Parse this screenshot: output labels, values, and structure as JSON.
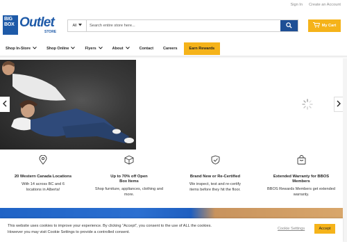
{
  "top_links": {
    "sign_in": "Sign In",
    "create_account": "Create an Account"
  },
  "logo": {
    "box_text": "BIG BOX",
    "outlet_text": "Outlet",
    "store_text": "STORE"
  },
  "search": {
    "category": "All",
    "placeholder": "Search entire store here..."
  },
  "cart": {
    "label": "My Cart"
  },
  "nav": {
    "items": [
      {
        "label": "Shop In-Store",
        "has_dropdown": true
      },
      {
        "label": "Shop Online",
        "has_dropdown": true
      },
      {
        "label": "Flyers",
        "has_dropdown": true
      },
      {
        "label": "About",
        "has_dropdown": true
      },
      {
        "label": "Contact",
        "has_dropdown": false
      },
      {
        "label": "Careers",
        "has_dropdown": false
      }
    ],
    "earn_rewards": "Earn Rewards"
  },
  "features": [
    {
      "icon": "map-pin-icon",
      "title": "20 Western Canada Locations",
      "text": "With 14 across BC and 6 locations in Alberta!"
    },
    {
      "icon": "box-icon",
      "title": "Up to 70% off Open Box Items",
      "text": "Shop furniture, appliances, clothing and more."
    },
    {
      "icon": "shield-check-icon",
      "title": "Brand New or Re-Certified",
      "text": "We inspect, test and re-certify items before they hit the floor."
    },
    {
      "icon": "bag-icon",
      "title": "Extended Warranty for BBOS Members",
      "text": "BBOS Rewards Members get extended warranty."
    }
  ],
  "cookie": {
    "text": "This website uses cookies to improve your experience. By clicking “Accept”, you consent to the use of ALL the cookies. However you may visit Cookie Settings to provide a controlled consent.",
    "settings_label": "Cookie Settings",
    "accept_label": "Accept"
  },
  "colors": {
    "brand_blue": "#1e5aa8",
    "accent_yellow": "#f5b31a",
    "search_button": "#1e4f95"
  }
}
